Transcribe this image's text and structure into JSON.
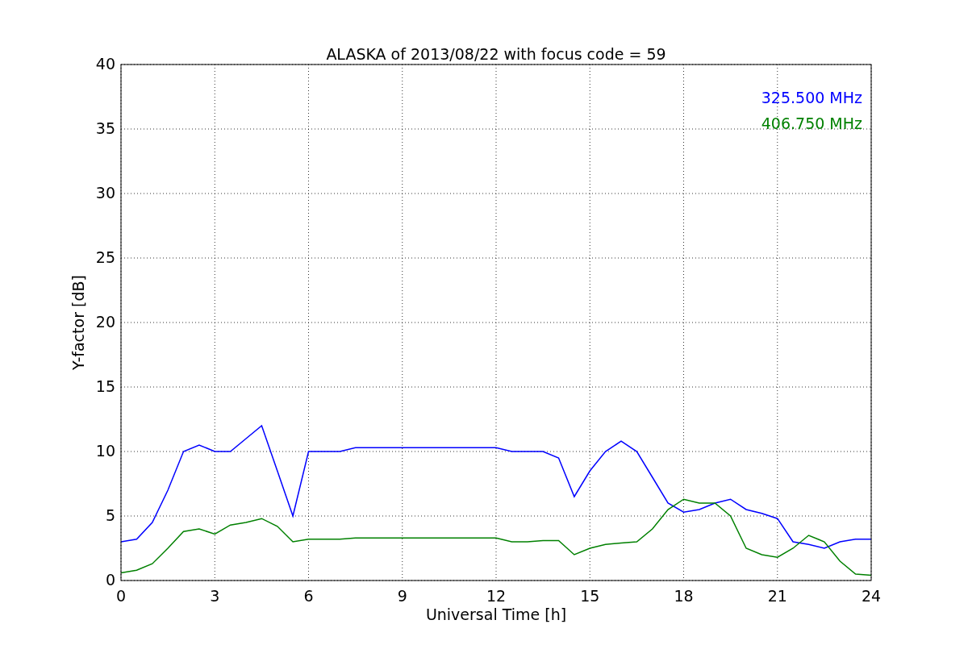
{
  "figure": {
    "chart_data": {
      "type": "line",
      "title": "ALASKA of 2013/08/22 with focus code = 59",
      "xlabel": "Universal Time [h]",
      "ylabel": "Y-factor [dB]",
      "x": [
        0,
        0.5,
        1,
        1.5,
        2,
        2.5,
        3,
        3.5,
        4,
        4.5,
        5,
        5.5,
        6,
        6.5,
        7,
        7.5,
        8,
        8.5,
        9,
        9.5,
        10,
        10.5,
        11,
        11.5,
        12,
        12.5,
        13,
        13.5,
        14,
        14.5,
        15,
        15.5,
        16,
        16.5,
        17,
        17.5,
        18,
        18.5,
        19,
        19.5,
        20,
        20.5,
        21,
        21.5,
        22,
        22.5,
        23,
        23.5,
        24
      ],
      "series": [
        {
          "name": "325.500 MHz",
          "color": "#0000ff",
          "values": [
            3,
            3.2,
            4.5,
            7,
            10,
            10.5,
            10,
            10,
            11,
            12,
            8.5,
            5,
            10,
            10,
            10,
            10.3,
            10.3,
            10.3,
            10.3,
            10.3,
            10.3,
            10.3,
            10.3,
            10.3,
            10.3,
            10,
            10,
            10,
            9.5,
            6.5,
            8.5,
            10,
            10.8,
            10,
            8,
            6,
            5.3,
            5.5,
            6,
            6.3,
            5.5,
            5.2,
            4.8,
            3,
            2.8,
            2.5,
            3,
            3.2,
            3.2
          ]
        },
        {
          "name": "406.750 MHz",
          "color": "#008000",
          "values": [
            0.6,
            0.8,
            1.3,
            2.5,
            3.8,
            4,
            3.6,
            4.3,
            4.5,
            4.8,
            4.2,
            3,
            3.2,
            3.2,
            3.2,
            3.3,
            3.3,
            3.3,
            3.3,
            3.3,
            3.3,
            3.3,
            3.3,
            3.3,
            3.3,
            3,
            3,
            3.1,
            3.1,
            2,
            2.5,
            2.8,
            2.9,
            3,
            4,
            5.5,
            6.3,
            6,
            6,
            5,
            2.5,
            2,
            1.8,
            2.5,
            3.5,
            3,
            1.5,
            0.5,
            0.4
          ]
        }
      ],
      "grid": true,
      "xlim": [
        0,
        24
      ],
      "ylim": [
        0,
        40
      ],
      "xticks": [
        0,
        3,
        6,
        9,
        12,
        15,
        18,
        21,
        24
      ],
      "yticks": [
        0,
        5,
        10,
        15,
        20,
        25,
        30,
        35,
        40
      ]
    }
  }
}
